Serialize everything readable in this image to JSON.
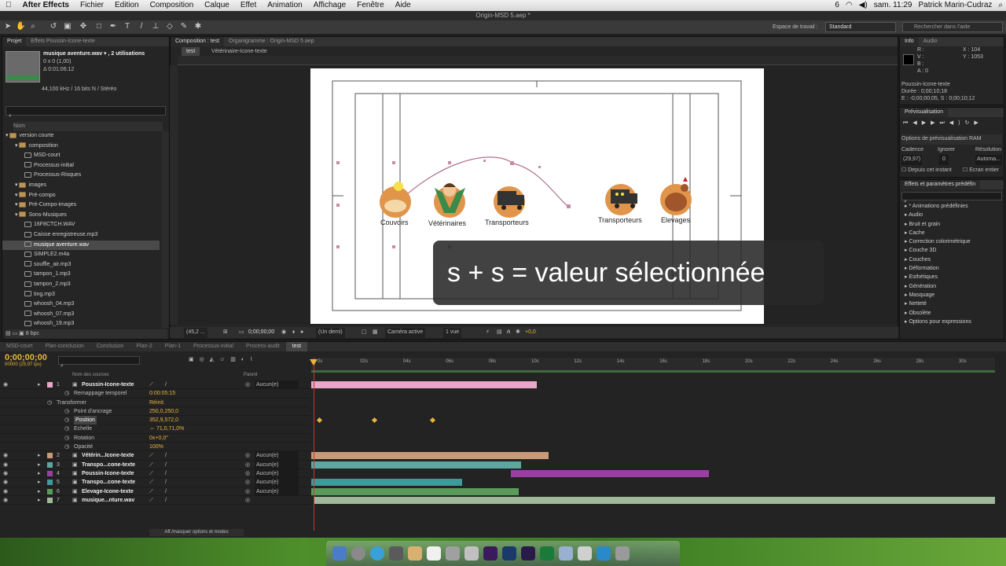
{
  "menubar": {
    "app": "After Effects",
    "items": [
      "Fichier",
      "Edition",
      "Composition",
      "Calque",
      "Effet",
      "Animation",
      "Affichage",
      "Fenêtre",
      "Aide"
    ],
    "clock": "sam. 11:29",
    "user": "Patrick Marin-Cudraz",
    "badge": "6"
  },
  "window": {
    "title": "Origin-MSD 5.aep *"
  },
  "workspace": {
    "label": "Espace de travail :",
    "value": "Standard",
    "search_placeholder": "Rechercher dans l'aide"
  },
  "project": {
    "tab": "Projet",
    "effects_tab": "Effets Poussin-Icone-texte",
    "file_name": "musique aventure.wav ▾ , 2 utilisations",
    "dims": "0 x 0 (1,00)",
    "duration": "Δ 0:01:06:12",
    "audio": "44,100 kHz / 16 bits N / Stéréo",
    "col_name": "Nom",
    "bpc": "8 bpc",
    "items": [
      {
        "label": "version courte",
        "type": "folder",
        "indent": 0
      },
      {
        "label": "composition",
        "type": "folder",
        "indent": 1
      },
      {
        "label": "MSD-court",
        "type": "comp",
        "indent": 2
      },
      {
        "label": "Processus-initial",
        "type": "comp",
        "indent": 2
      },
      {
        "label": "Processus-Risques",
        "type": "comp",
        "indent": 2
      },
      {
        "label": "images",
        "type": "folder",
        "indent": 1
      },
      {
        "label": "Pré-compo",
        "type": "folder",
        "indent": 1
      },
      {
        "label": "Pré-Compo-images",
        "type": "folder",
        "indent": 1
      },
      {
        "label": "Sons-Musiques",
        "type": "folder",
        "indent": 1
      },
      {
        "label": "16F8CTCH.WAV",
        "type": "file",
        "indent": 2
      },
      {
        "label": "Caisse enregistreuse.mp3",
        "type": "file",
        "indent": 2
      },
      {
        "label": "musique aventure.wav",
        "type": "file",
        "indent": 2,
        "selected": true
      },
      {
        "label": "SIMPLE2.m4a",
        "type": "file",
        "indent": 2
      },
      {
        "label": "souffle_air.mp3",
        "type": "file",
        "indent": 2
      },
      {
        "label": "tampon_1.mp3",
        "type": "file",
        "indent": 2
      },
      {
        "label": "tampon_2.mp3",
        "type": "file",
        "indent": 2
      },
      {
        "label": "ting.mp3",
        "type": "file",
        "indent": 2
      },
      {
        "label": "whoosh_04.mp3",
        "type": "file",
        "indent": 2
      },
      {
        "label": "whoosh_07.mp3",
        "type": "file",
        "indent": 2
      },
      {
        "label": "whoosh_19.mp3",
        "type": "file",
        "indent": 2
      }
    ]
  },
  "viewer": {
    "comp_tab": "Composition : test",
    "org_tab": "Organigramme : Origin-MSD 5.aep",
    "crumb1": "test",
    "crumb2": "Vétérinaire-Icone-texte",
    "labels": {
      "couvoirs": "Couvoirs",
      "veterinaires": "Vétérinaires",
      "transporteurs1": "Transporteurs",
      "transporteurs2": "Transporteurs",
      "elevages": "Elevages"
    },
    "footer": {
      "zoom": "(45,2 ...",
      "time": "0;00;00;00",
      "res": "(Un demi)",
      "camera": "Caméra active",
      "views": "1 vue",
      "offset": "+0,0"
    }
  },
  "overlay_text": "s + s = valeur sélectionnée",
  "info": {
    "tab": "Info",
    "audio_tab": "Audio",
    "r": "R :",
    "g": "V :",
    "b": "B :",
    "a": "A : 0",
    "x": "X : 104",
    "y": "Y : 1053",
    "layer": "Poussin-Icone-texte",
    "dur": "Durée : 0;00;10;18",
    "range": "E : -0;00;00;05, S : 0;00;10;12"
  },
  "preview": {
    "tab": "Prévisualisation",
    "ram": "Options de prévisualisation RAM",
    "cadence": "Cadence",
    "ignorer": "Ignorer",
    "resolution": "Résolution",
    "fps": "(29,97)",
    "skip": "0",
    "res_val": "Automa...",
    "chk1": "Depuis cet instant",
    "chk2": "Ecran entier"
  },
  "effects": {
    "tab": "Effets et paramètres prédéfin",
    "items": [
      "* Animations prédéfinies",
      "Audio",
      "Bruit et grain",
      "Cache",
      "Correction colorimétrique",
      "Couche 3D",
      "Couches",
      "Déformation",
      "Esthétiques",
      "Génération",
      "Masquage",
      "Netteté",
      "Obsolète",
      "Options pour expressions"
    ]
  },
  "timeline_tabs": [
    "MSD-court",
    "Plan-conclusion",
    "Conclusion",
    "Plan-2",
    "Plan-1",
    "Processus-initial",
    "Process-audit",
    "test"
  ],
  "timeline": {
    "timecode": "0;00;00;00",
    "fps": "00000 (29,97 ips)",
    "col_source": "Nom des sources",
    "col_parent": "Parent",
    "toggle": "Aff./masquer options et modes",
    "ticks": [
      "0s",
      "02s",
      "04s",
      "06s",
      "08s",
      "10s",
      "12s",
      "14s",
      "16s",
      "18s",
      "20s",
      "22s",
      "24s",
      "26s",
      "28s",
      "30s"
    ],
    "rows": [
      {
        "num": "1",
        "name": "Poussin-Icone-texte",
        "parent": "Aucun(e)",
        "color": "#e9a6c8"
      },
      {
        "prop": "Remappage temporel",
        "value": "0:00:05:15"
      },
      {
        "prop": "Transformer",
        "value": "Réinit."
      },
      {
        "prop": "Point d'ancrage",
        "value": "250,0,250,0"
      },
      {
        "prop": "Position",
        "value": "352,9,572,0"
      },
      {
        "prop": "Echelle",
        "value": "⇔ 71,0,71,0%"
      },
      {
        "prop": "Rotation",
        "value": "0x+0,0°"
      },
      {
        "prop": "Opacité",
        "value": "100%"
      },
      {
        "num": "2",
        "name": "Vétérin...Icone-texte",
        "parent": "Aucun(e)",
        "color": "#c89a77"
      },
      {
        "num": "3",
        "name": "Transpo...cone-texte",
        "parent": "Aucun(e)",
        "color": "#5fa6a2"
      },
      {
        "num": "4",
        "name": "Poussin-Icone-texte",
        "parent": "Aucun(e)",
        "color": "#9b3ea3"
      },
      {
        "num": "5",
        "name": "Transpo...cone-texte",
        "parent": "Aucun(e)",
        "color": "#3f9a9a"
      },
      {
        "num": "6",
        "name": "Elevage-Icone-texte",
        "parent": "Aucun(e)",
        "color": "#5a9a5a"
      },
      {
        "num": "7",
        "name": "musique...nture.wav",
        "parent": "",
        "color": "#9fb89a"
      }
    ]
  }
}
